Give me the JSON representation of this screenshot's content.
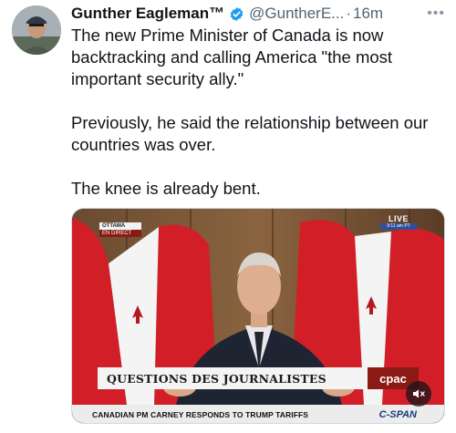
{
  "tweet": {
    "author_name": "Gunther Eagleman™",
    "handle": "@GuntherE...",
    "separator": "·",
    "time": "16m",
    "more_icon": "more-horizontal-icon",
    "paragraphs": [
      "The new Prime Minister of Canada is now backtracking and calling America \"the most important security ally.\"",
      "Previously, he said the relationship between our countries was over.",
      "The knee is already bent."
    ]
  },
  "video": {
    "location_label": "OTTAWA",
    "location_sub": "EN DIRECT",
    "live_label": "LIVE",
    "live_time": "9:11 am PT",
    "lower_third_title": "QUESTIONS DES JOURNALISTES",
    "lower_third_brand": "cpac",
    "ticker_text": "CANADIAN PM CARNEY RESPONDS TO TRUMP TARIFFS",
    "ticker_brand": "C-SPAN",
    "mute_icon": "volume-muted-icon"
  },
  "colors": {
    "verified": "#1d9bf0",
    "text": "#0f1419",
    "muted_text": "#536471",
    "flag_red": "#d21f27",
    "cpac_red": "#8b1a14"
  }
}
